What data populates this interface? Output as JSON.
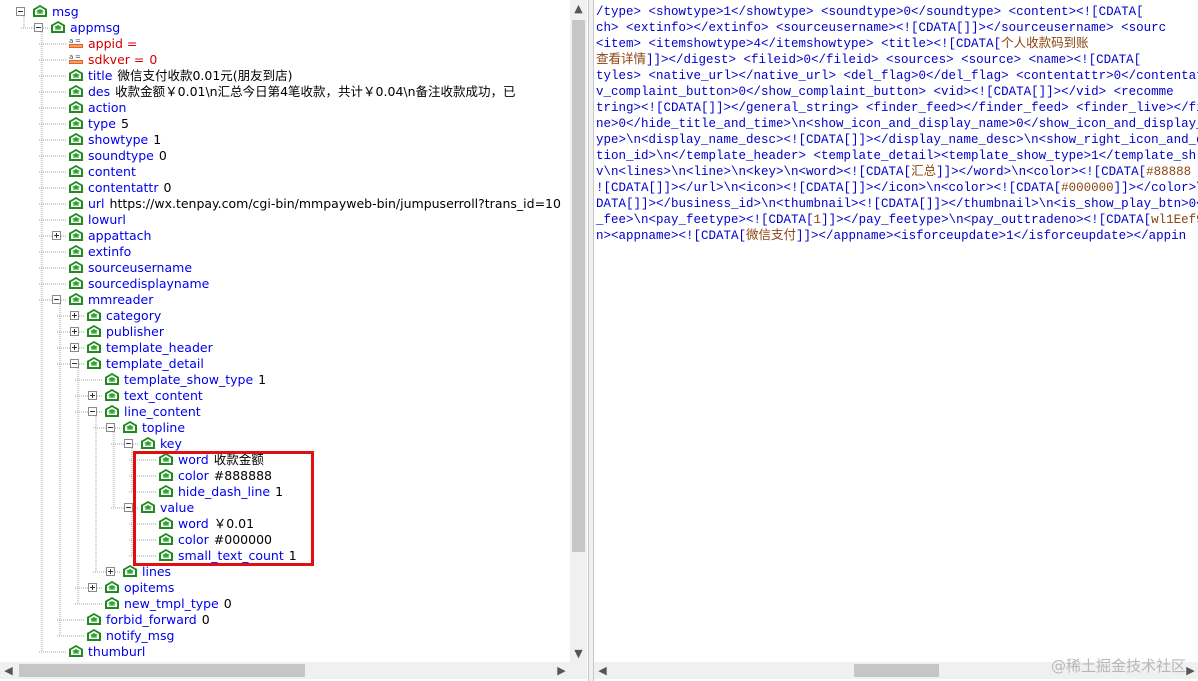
{
  "tree": {
    "nodes": [
      {
        "depth": 0,
        "expander": "minus",
        "icon": "element",
        "name": "msg",
        "value": ""
      },
      {
        "depth": 1,
        "expander": "minus",
        "icon": "element",
        "name": "appmsg",
        "value": ""
      },
      {
        "depth": 2,
        "expander": "",
        "icon": "attribute",
        "name": "appid =",
        "value": ""
      },
      {
        "depth": 2,
        "expander": "",
        "icon": "attribute",
        "name": "sdkver =",
        "value": "0"
      },
      {
        "depth": 2,
        "expander": "",
        "icon": "element",
        "name": "title",
        "value": "微信支付收款0.01元(朋友到店)"
      },
      {
        "depth": 2,
        "expander": "",
        "icon": "element",
        "name": "des",
        "value": "收款金额￥0.01\\n汇总今日第4笔收款，共计￥0.04\\n备注收款成功，已"
      },
      {
        "depth": 2,
        "expander": "",
        "icon": "element",
        "name": "action",
        "value": ""
      },
      {
        "depth": 2,
        "expander": "",
        "icon": "element",
        "name": "type",
        "value": "5"
      },
      {
        "depth": 2,
        "expander": "",
        "icon": "element",
        "name": "showtype",
        "value": "1"
      },
      {
        "depth": 2,
        "expander": "",
        "icon": "element",
        "name": "soundtype",
        "value": "0"
      },
      {
        "depth": 2,
        "expander": "",
        "icon": "element",
        "name": "content",
        "value": ""
      },
      {
        "depth": 2,
        "expander": "",
        "icon": "element",
        "name": "contentattr",
        "value": "0"
      },
      {
        "depth": 2,
        "expander": "",
        "icon": "element",
        "name": "url",
        "value": "https://wx.tenpay.com/cgi-bin/mmpayweb-bin/jumpuserroll?trans_id=10"
      },
      {
        "depth": 2,
        "expander": "",
        "icon": "element",
        "name": "lowurl",
        "value": ""
      },
      {
        "depth": 2,
        "expander": "plus",
        "icon": "element",
        "name": "appattach",
        "value": ""
      },
      {
        "depth": 2,
        "expander": "",
        "icon": "element",
        "name": "extinfo",
        "value": ""
      },
      {
        "depth": 2,
        "expander": "",
        "icon": "element",
        "name": "sourceusername",
        "value": ""
      },
      {
        "depth": 2,
        "expander": "",
        "icon": "element",
        "name": "sourcedisplayname",
        "value": ""
      },
      {
        "depth": 2,
        "expander": "minus",
        "icon": "element",
        "name": "mmreader",
        "value": ""
      },
      {
        "depth": 3,
        "expander": "plus",
        "icon": "element",
        "name": "category",
        "value": ""
      },
      {
        "depth": 3,
        "expander": "plus",
        "icon": "element",
        "name": "publisher",
        "value": ""
      },
      {
        "depth": 3,
        "expander": "plus",
        "icon": "element",
        "name": "template_header",
        "value": ""
      },
      {
        "depth": 3,
        "expander": "minus",
        "icon": "element",
        "name": "template_detail",
        "value": ""
      },
      {
        "depth": 4,
        "expander": "",
        "icon": "element",
        "name": "template_show_type",
        "value": "1"
      },
      {
        "depth": 4,
        "expander": "plus",
        "icon": "element",
        "name": "text_content",
        "value": ""
      },
      {
        "depth": 4,
        "expander": "minus",
        "icon": "element",
        "name": "line_content",
        "value": ""
      },
      {
        "depth": 5,
        "expander": "minus",
        "icon": "element",
        "name": "topline",
        "value": ""
      },
      {
        "depth": 6,
        "expander": "minus",
        "icon": "element",
        "name": "key",
        "value": ""
      },
      {
        "depth": 7,
        "expander": "",
        "icon": "element",
        "name": "word",
        "value": "收款金额"
      },
      {
        "depth": 7,
        "expander": "",
        "icon": "element",
        "name": "color",
        "value": "#888888"
      },
      {
        "depth": 7,
        "expander": "",
        "icon": "element",
        "name": "hide_dash_line",
        "value": "1"
      },
      {
        "depth": 6,
        "expander": "minus",
        "icon": "element",
        "name": "value",
        "value": ""
      },
      {
        "depth": 7,
        "expander": "",
        "icon": "element",
        "name": "word",
        "value": "￥0.01"
      },
      {
        "depth": 7,
        "expander": "",
        "icon": "element",
        "name": "color",
        "value": "#000000"
      },
      {
        "depth": 7,
        "expander": "",
        "icon": "element",
        "name": "small_text_count",
        "value": "1"
      },
      {
        "depth": 5,
        "expander": "plus",
        "icon": "element",
        "name": "lines",
        "value": ""
      },
      {
        "depth": 4,
        "expander": "plus",
        "icon": "element",
        "name": "opitems",
        "value": ""
      },
      {
        "depth": 4,
        "expander": "",
        "icon": "element",
        "name": "new_tmpl_type",
        "value": "0"
      },
      {
        "depth": 3,
        "expander": "",
        "icon": "element",
        "name": "forbid_forward",
        "value": "0"
      },
      {
        "depth": 3,
        "expander": "",
        "icon": "element",
        "name": "notify_msg",
        "value": ""
      },
      {
        "depth": 2,
        "expander": "",
        "icon": "element",
        "name": "thumburl",
        "value": ""
      }
    ]
  },
  "xml": {
    "lines": [
      [
        {
          "t": "/type>    <showtype>1</showtype>    <soundtype>0</soundtype>    <content><![CDATA["
        }
      ],
      [
        {
          "t": "ch>    <extinfo></extinfo>    <sourceusername><![CDATA[]]></sourceusername>    <sourc"
        }
      ],
      [
        {
          "t": "    <item>    <itemshowtype>4</itemshowtype>    <title><![CDATA["
        },
        {
          "t": "个人收款码到账",
          "c": 1
        }
      ],
      [
        {
          "t": "查看详情",
          "c": 1
        },
        {
          "t": "]]></digest>    <fileid>0</fileid>    <sources>    <source>    <name><![CDATA["
        }
      ],
      [
        {
          "t": "tyles>    <native_url></native_url>    <del_flag>0</del_flag>    <contentattr>0</contentattr"
        }
      ],
      [
        {
          "t": "v_complaint_button>0</show_complaint_button>    <vid><![CDATA[]]></vid>    <recomme"
        }
      ],
      [
        {
          "t": "tring><![CDATA[]]></general_string>    <finder_feed></finder_feed>    <finder_live></finde"
        }
      ],
      [
        {
          "t": "ne>0</hide_title_and_time>\\n<show_icon_and_display_name>0</show_icon_and_display_na"
        }
      ],
      [
        {
          "t": "ype>\\n<display_name_desc><![CDATA[]]></display_name_desc>\\n<show_right_icon_and_de"
        }
      ],
      [
        {
          "t": "tion_id>\\n</template_header>    <template_detail><template_show_type>1</template_sh"
        }
      ],
      [
        {
          "t": "v\\n<lines>\\n<line>\\n<key>\\n<word><![CDATA["
        },
        {
          "t": "汇总",
          "c": 1
        },
        {
          "t": "]]></word>\\n<color><![CDATA["
        },
        {
          "t": "#88888",
          "c": 1
        }
      ],
      [
        {
          "t": "![CDATA[]]></url>\\n<icon><![CDATA[]]></icon>\\n<color><![CDATA["
        },
        {
          "t": "#000000",
          "c": 1
        },
        {
          "t": "]]></color>\\n"
        }
      ],
      [
        {
          "t": "DATA[]]></business_id>\\n<thumbnail><![CDATA[]]></thumbnail>\\n<is_show_play_btn>0</"
        }
      ],
      [
        {
          "t": "_fee>\\n<pay_feetype><![CDATA["
        },
        {
          "t": "1",
          "c": 1
        },
        {
          "t": "]]></pay_feetype>\\n<pay_outtradeno><![CDATA["
        },
        {
          "t": "wl1Eef9De",
          "c": 1
        }
      ],
      [
        {
          "t": "n><appname><![CDATA["
        },
        {
          "t": "微信支付",
          "c": 1
        },
        {
          "t": "]]></appname><isforceupdate>1</isforceupdate></appin"
        }
      ]
    ]
  },
  "watermark": "@稀土掘金技术社区",
  "icons": {
    "element": "tree-element-icon",
    "attribute": "tree-attribute-icon"
  }
}
